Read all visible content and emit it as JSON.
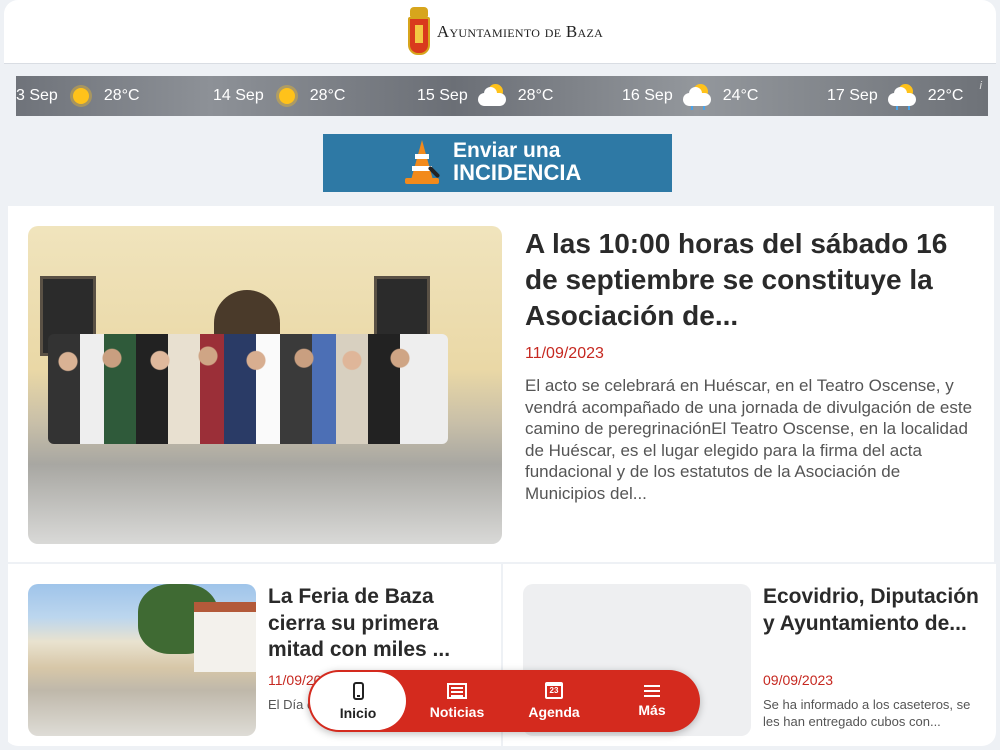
{
  "header": {
    "logo_text": "Ayuntamiento de Baza",
    "logo_icon": "town-crest-icon"
  },
  "weather": {
    "info_label": "i",
    "days": [
      {
        "date": "3 Sep",
        "icon": "sun-icon",
        "temp": "28°C"
      },
      {
        "date": "14 Sep",
        "icon": "sun-icon",
        "temp": "28°C"
      },
      {
        "date": "15 Sep",
        "icon": "partly-cloudy-icon",
        "temp": "28°C"
      },
      {
        "date": "16 Sep",
        "icon": "cloud-rain-sun-icon",
        "temp": "24°C"
      },
      {
        "date": "17 Sep",
        "icon": "cloud-rain-sun-icon",
        "temp": "22°C"
      }
    ]
  },
  "incidencia": {
    "line1": "Enviar una",
    "line2": "INCIDENCIA"
  },
  "featured": {
    "title": "A las 10:00 horas del sábado 16 de septiembre se constituye la Asociación de...",
    "date": "11/09/2023",
    "excerpt": "El acto se celebrará en Huéscar, en el Teatro Oscense, y vendrá acompañado de una jornada de divulgación de este camino de peregrinaciónEl Teatro Oscense, en la localidad de Huéscar, es el lugar elegido para la firma del acta fundacional y de los estatutos de la Asociación de Municipios del..."
  },
  "news": [
    {
      "title": "La Feria de Baza cierra su primera mitad con miles ...",
      "date": "11/09/2023",
      "excerpt": "El Día de la ... parte de ..."
    },
    {
      "title": "Ecovidrio, Diputación y Ayuntamiento de...",
      "date": "09/09/2023",
      "excerpt": "Se ha informado a los caseteros, se les han entregado cubos con..."
    }
  ],
  "nav": {
    "items": [
      {
        "label": "Inicio",
        "icon": "phone-icon",
        "active": true
      },
      {
        "label": "Noticias",
        "icon": "newspaper-icon",
        "active": false
      },
      {
        "label": "Agenda",
        "icon": "calendar-icon",
        "active": false,
        "badge": "23"
      },
      {
        "label": "Más",
        "icon": "menu-icon",
        "active": false
      }
    ]
  },
  "colors": {
    "accent_red": "#d42a1e",
    "date_red": "#c62820",
    "incidencia_blue": "#2e79a5"
  }
}
